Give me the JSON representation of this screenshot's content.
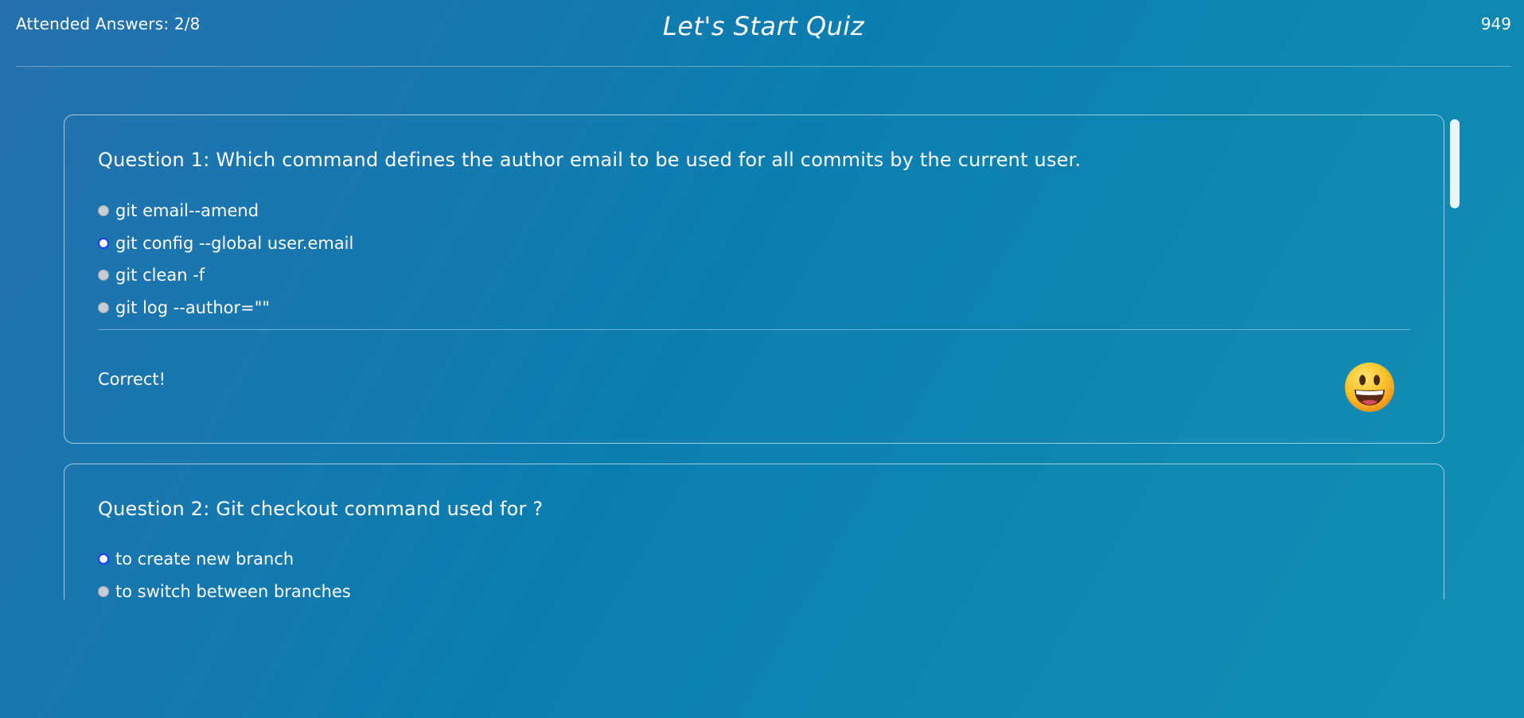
{
  "header": {
    "attended_label": "Attended Answers: 2/8",
    "title": "Let's Start Quiz",
    "timer": "949"
  },
  "questions": [
    {
      "text": "Question 1:  Which command defines the author email to be used for all commits by the current user.",
      "options": [
        {
          "label": "git email--amend",
          "selected": false
        },
        {
          "label": "git config --global user.email",
          "selected": true
        },
        {
          "label": "git clean -f",
          "selected": false
        },
        {
          "label": "git log --author=\"\"",
          "selected": false
        }
      ],
      "feedback": "Correct!",
      "feedback_icon": "grinning-face-icon"
    },
    {
      "text": "Question 2:  Git checkout command used for ?",
      "options": [
        {
          "label": "to create new branch",
          "selected": true
        },
        {
          "label": "to switch between branches",
          "selected": false
        }
      ]
    }
  ],
  "colors": {
    "background_start": "#2570ad",
    "background_end": "#1290b3",
    "text": "#ffffff",
    "radio_selected_border": "#1a3cff",
    "radio_unselected": "#c7cdd4"
  }
}
